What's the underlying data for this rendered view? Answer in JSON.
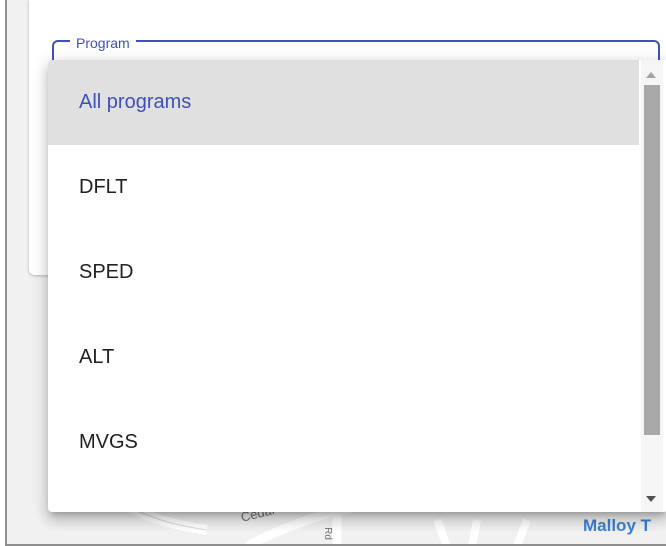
{
  "select": {
    "label": "Program",
    "accent_color": "#3f51b5"
  },
  "menu": {
    "items": [
      {
        "label": "All programs",
        "selected": true
      },
      {
        "label": "DFLT",
        "selected": false
      },
      {
        "label": "SPED",
        "selected": false
      },
      {
        "label": "ALT",
        "selected": false
      },
      {
        "label": "MVGS",
        "selected": false
      }
    ]
  },
  "map": {
    "labels": {
      "street": "Cedar Creek",
      "road_abbrev": "Rd",
      "place": "Malloy T"
    }
  }
}
